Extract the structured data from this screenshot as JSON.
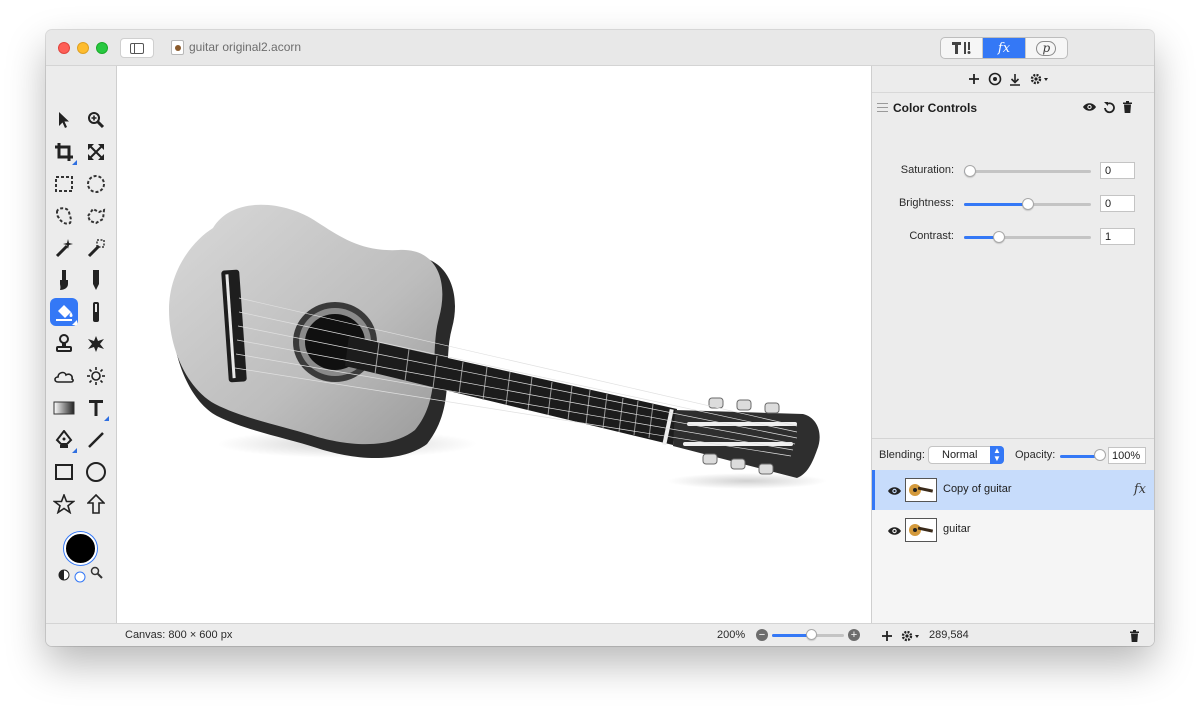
{
  "window": {
    "document_title": "guitar original2.acorn"
  },
  "inspector_tabs": [
    {
      "id": "tools",
      "label": ""
    },
    {
      "id": "fx",
      "label": "fx"
    },
    {
      "id": "p",
      "label": "p"
    }
  ],
  "filter": {
    "title": "Color Controls",
    "params": [
      {
        "label": "Saturation:",
        "value": "0",
        "level": 0.0
      },
      {
        "label": "Brightness:",
        "value": "0",
        "level": 0.5
      },
      {
        "label": "Contrast:",
        "value": "1",
        "level": 0.25
      }
    ]
  },
  "blending": {
    "label": "Blending:",
    "mode": "Normal",
    "opacity_label": "Opacity:",
    "opacity": "100%"
  },
  "layers": [
    {
      "name": "Copy of guitar",
      "selected": true,
      "has_fx": true,
      "fx_label": "fx"
    },
    {
      "name": "guitar",
      "selected": false,
      "has_fx": false
    }
  ],
  "status": {
    "canvas": "Canvas: 800 × 600 px",
    "zoom": "200%",
    "zoom_level": 0.55,
    "coords": "289,584"
  },
  "colors": {
    "accent": "#3478f6",
    "foreground_swatch": "#000000"
  },
  "tools": [
    "select-arrow-icon",
    "zoom-icon",
    "crop-icon",
    "transform-icon",
    "rect-select-icon",
    "ellipse-select-icon",
    "lasso-icon",
    "polygon-lasso-icon",
    "magic-wand-icon",
    "magic-wand-alt-icon",
    "brush-icon",
    "pencil-icon",
    "paint-bucket-icon",
    "smudge-icon",
    "clone-stamp-icon",
    "burn-icon",
    "cloud-icon",
    "sun-icon",
    "gradient-icon",
    "text-icon",
    "pen-icon",
    "line-icon",
    "rectangle-icon",
    "circle-icon",
    "star-icon",
    "arrow-icon"
  ]
}
